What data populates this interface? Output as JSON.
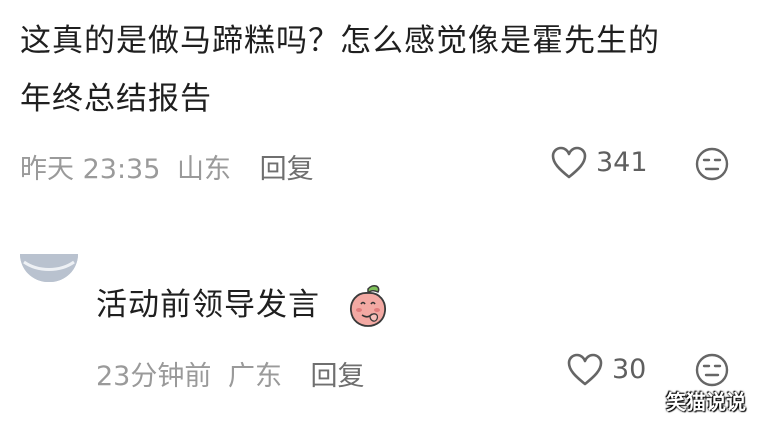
{
  "comments": [
    {
      "text_line1": "这真的是做马蹄糕吗？怎么感觉像是霍先生的",
      "text_line2": "年终总结报告",
      "time": "昨天 23:35",
      "location": "山东",
      "reply_label": "回复",
      "likes": "341"
    },
    {
      "text": "活动前领导发言",
      "time": "23分钟前",
      "location": "广东",
      "reply_label": "回复",
      "likes": "30"
    }
  ],
  "icons": {
    "like": "heart-outline-icon",
    "dislike": "meh-face-icon",
    "emoji": "peach-emoji-icon"
  },
  "watermark": "笑猫说说",
  "colors": {
    "text": "#1f1f1f",
    "meta": "#9a9a9a",
    "avatar": "#b9c2cf"
  }
}
